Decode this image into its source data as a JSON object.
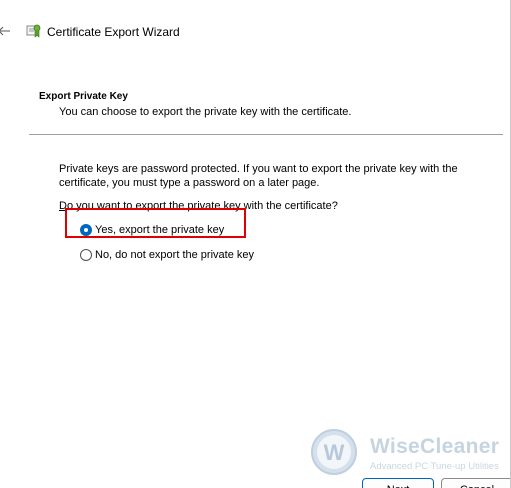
{
  "window": {
    "title": "Certificate Export Wizard",
    "back_icon": "back-arrow-icon",
    "app_icon": "certificate-icon"
  },
  "header": {
    "title": "Export Private Key",
    "description": "You can choose to export the private key with the certificate."
  },
  "body": {
    "info_text": "Private keys are password protected. If you want to export the private key with the certificate, you must type a password on a later page.",
    "question_prefix": "",
    "question_underlined": "D",
    "question_rest": "o you want to export the private key with the certificate?"
  },
  "options": [
    {
      "label": "Yes, export the private key",
      "checked": true
    },
    {
      "label": "No, do not export the private key",
      "checked": false
    }
  ],
  "buttons": {
    "next_label": "Next",
    "cancel_label": "Cancel"
  },
  "watermark": {
    "name": "WiseCleaner",
    "tagline": "Advanced PC Tune-up Utilities"
  },
  "colors": {
    "accent": "#0067c0",
    "highlight": "#e00000"
  }
}
